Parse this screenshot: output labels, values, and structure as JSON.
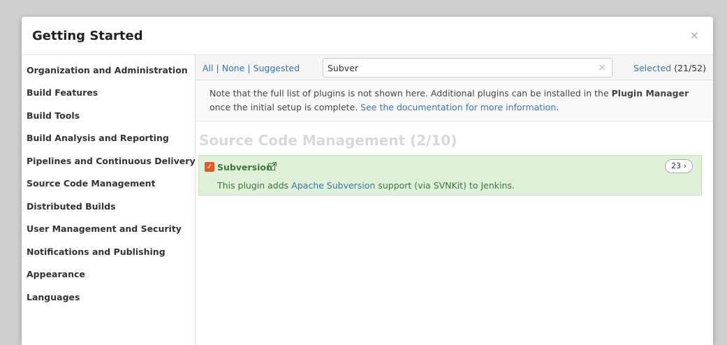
{
  "dialog": {
    "title": "Getting Started",
    "close_glyph": "×"
  },
  "sidebar": {
    "items": [
      {
        "label": "Organization and Administration"
      },
      {
        "label": "Build Features"
      },
      {
        "label": "Build Tools"
      },
      {
        "label": "Build Analysis and Reporting"
      },
      {
        "label": "Pipelines and Continuous Delivery"
      },
      {
        "label": "Source Code Management"
      },
      {
        "label": "Distributed Builds"
      },
      {
        "label": "User Management and Security"
      },
      {
        "label": "Notifications and Publishing"
      },
      {
        "label": "Appearance"
      },
      {
        "label": "Languages"
      }
    ]
  },
  "toolbar": {
    "filter_all": "All",
    "filter_none": "None",
    "filter_suggested": "Suggested",
    "separator": "|",
    "search_value": "Subver",
    "search_clear_glyph": "×",
    "selected_label": "Selected",
    "selected_count": "(21/52)"
  },
  "note": {
    "text_part1": "Note that the full list of plugins is not shown here. Additional plugins can be installed in the ",
    "plugin_manager": "Plugin Manager",
    "text_part2": " once the initial setup is complete. ",
    "doc_link": "See the documentation for more information",
    "text_end": "."
  },
  "section": {
    "title": "Source Code Management (2/10)"
  },
  "plugin": {
    "checkbox_glyph": "✓",
    "name": "Subversion",
    "desc_part1": "This plugin adds ",
    "desc_link": "Apache Subversion",
    "desc_part2": " support (via SVNKit) to Jenkins.",
    "dependency_count": "23 ›",
    "checked": true,
    "icon": "external-link-icon"
  },
  "colors": {
    "accent_link": "#2e77b7",
    "checkbox": "#e45a24",
    "card_bg": "#dff0d8",
    "card_text": "#3c763d"
  }
}
